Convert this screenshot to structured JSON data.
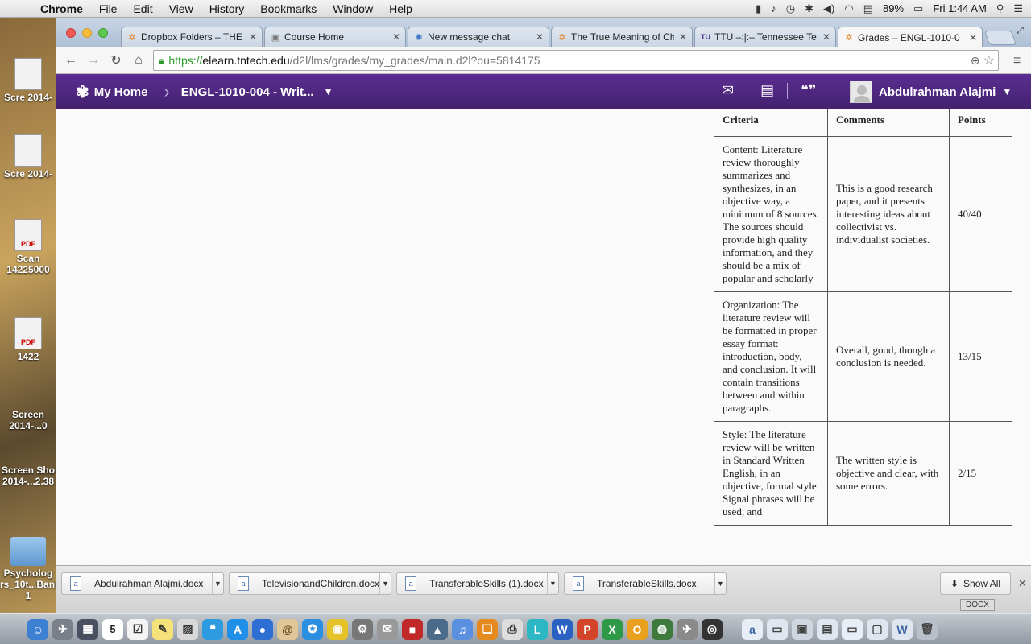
{
  "menubar": {
    "app": "Chrome",
    "items": [
      "File",
      "Edit",
      "View",
      "History",
      "Bookmarks",
      "Window",
      "Help"
    ],
    "battery": "89%",
    "clock": "Fri 1:44 AM"
  },
  "desktop": {
    "items": [
      {
        "label": "Scre 2014-"
      },
      {
        "label": "Scre 2014-"
      },
      {
        "label": "Scan 14225000",
        "badge": "PDF"
      },
      {
        "label": "1422",
        "badge": "PDF"
      },
      {
        "label": "Screen 2014-...0"
      },
      {
        "label": "Screen Sho 2014-...2.38"
      },
      {
        "label": "Psycholog rs_10t...Bank-1"
      }
    ]
  },
  "tabs": [
    {
      "title": "Dropbox Folders – THE",
      "icon": "dropbox-icon"
    },
    {
      "title": "Course Home",
      "icon": "page-icon"
    },
    {
      "title": "New message chat",
      "icon": "chat-icon"
    },
    {
      "title": "The True Meaning of Ch",
      "icon": "dropbox-icon"
    },
    {
      "title": "TTU –:|:– Tennessee Te",
      "icon": "ttu-icon"
    },
    {
      "title": "Grades – ENGL-1010-0",
      "icon": "d2l-icon",
      "active": true
    }
  ],
  "address": {
    "scheme": "https://",
    "host": "elearn.tntech.edu",
    "path": "/d2l/lms/grades/my_grades/main.d2l?ou=5814175"
  },
  "d2l": {
    "home_label": "My Home",
    "course_label": "ENGL-1010-004 - Writ...",
    "user_name": "Abdulrahman Alajmi"
  },
  "rubric": {
    "headers": {
      "criteria": "Criteria",
      "comments": "Comments",
      "points": "Points"
    },
    "rows": [
      {
        "criteria": "Content: Literature review thoroughly summarizes and synthesizes, in an objective way, a minimum of 8 sources. The sources should provide high quality information, and they should be a mix of popular and scholarly",
        "comments": "This is a good research paper, and it presents interesting ideas about collectivist vs. individualist societies.",
        "points": "40/40"
      },
      {
        "criteria": "Organization: The literature review will be formatted in proper essay format: introduction, body, and conclusion. It will contain transitions between and within paragraphs.",
        "comments": "Overall, good, though a conclusion is needed.",
        "points": "13/15"
      },
      {
        "criteria": "Style: The literature review will be written in Standard Written English, in an objective, formal style. Signal phrases will be used, and",
        "comments": "The written style is objective and clear, with some errors.",
        "points": "2/15"
      }
    ]
  },
  "downloads": [
    {
      "name": "Abdulrahman Alajmi.docx"
    },
    {
      "name": "TelevisionandChildren.docx"
    },
    {
      "name": "TransferableSkills (1).docx"
    },
    {
      "name": "TransferableSkills.docx"
    }
  ],
  "show_all_label": "Show All",
  "dock": {
    "calendar_day": "5",
    "docx_label": "DOCX"
  }
}
